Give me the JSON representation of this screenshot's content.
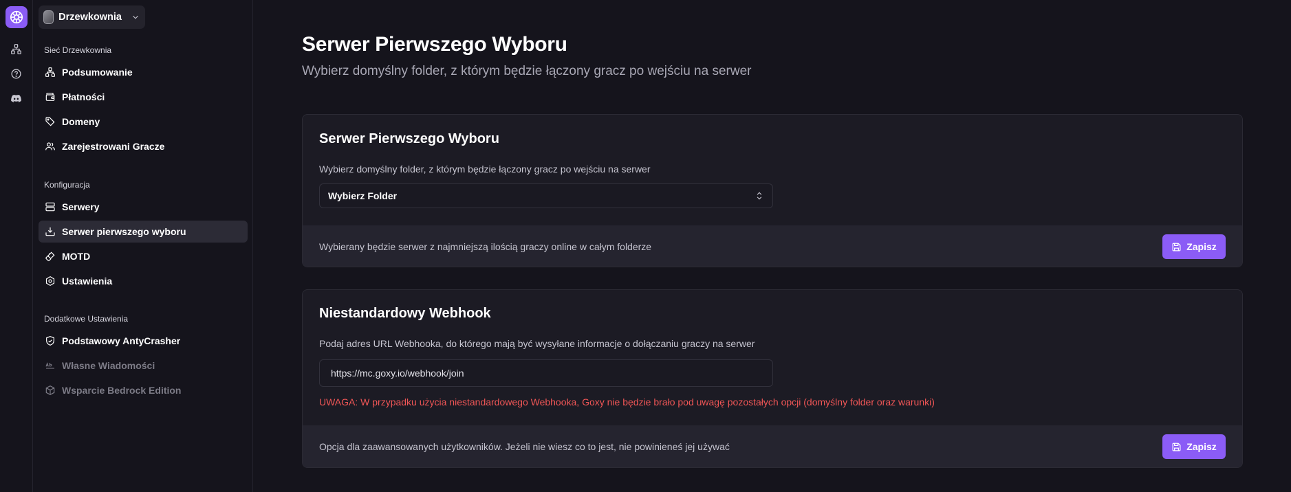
{
  "org": {
    "name": "Drzewkownia"
  },
  "sidebar": {
    "sections": [
      {
        "label": "Sieć Drzewkownia",
        "items": [
          {
            "label": "Podsumowanie",
            "icon": "network-icon"
          },
          {
            "label": "Płatności",
            "icon": "wallet-icon"
          },
          {
            "label": "Domeny",
            "icon": "tag-icon"
          },
          {
            "label": "Zarejestrowani Gracze",
            "icon": "users-icon"
          }
        ]
      },
      {
        "label": "Konfiguracja",
        "items": [
          {
            "label": "Serwery",
            "icon": "server-icon"
          },
          {
            "label": "Serwer pierwszego wyboru",
            "icon": "download-tray-icon",
            "active": true
          },
          {
            "label": "MOTD",
            "icon": "brush-icon"
          },
          {
            "label": "Ustawienia",
            "icon": "settings-hex-icon"
          }
        ]
      },
      {
        "label": "Dodatkowe Ustawienia",
        "items": [
          {
            "label": "Podstawowy AntyCrasher",
            "icon": "shield-check-icon"
          },
          {
            "label": "Własne Wiadomości",
            "icon": "ab-text-icon",
            "disabled": true
          },
          {
            "label": "Wsparcie Bedrock Edition",
            "icon": "cube-icon",
            "disabled": true
          }
        ]
      }
    ]
  },
  "page": {
    "title": "Serwer Pierwszego Wyboru",
    "subtitle": "Wybierz domyślny folder, z którym będzie łączony gracz po wejściu na serwer"
  },
  "card_default": {
    "title": "Serwer Pierwszego Wyboru",
    "description": "Wybierz domyślny folder, z którym będzie łączony gracz po wejściu na serwer",
    "select_value": "Wybierz Folder",
    "footer_text": "Wybierany będzie serwer z najmniejszą ilością graczy online w całym folderze",
    "save_label": "Zapisz"
  },
  "card_webhook": {
    "title": "Niestandardowy Webhook",
    "description": "Podaj adres URL Webhooka, do którego mają być wysyłane informacje o dołączaniu graczy na serwer",
    "input_value": "https://mc.goxy.io/webhook/join",
    "warning": "UWAGA: W przypadku użycia niestandardowego Webhooka, Goxy nie będzie brało pod uwagę pozostałych opcji (domyślny folder oraz warunki)",
    "footer_text": "Opcja dla zaawansowanych użytkowników. Jeżeli nie wiesz co to jest, nie powinieneś jej używać",
    "save_label": "Zapisz"
  },
  "colors": {
    "accent": "#8b5cf6",
    "background": "#15141c",
    "card": "#1c1b24",
    "warning": "#f15656"
  }
}
